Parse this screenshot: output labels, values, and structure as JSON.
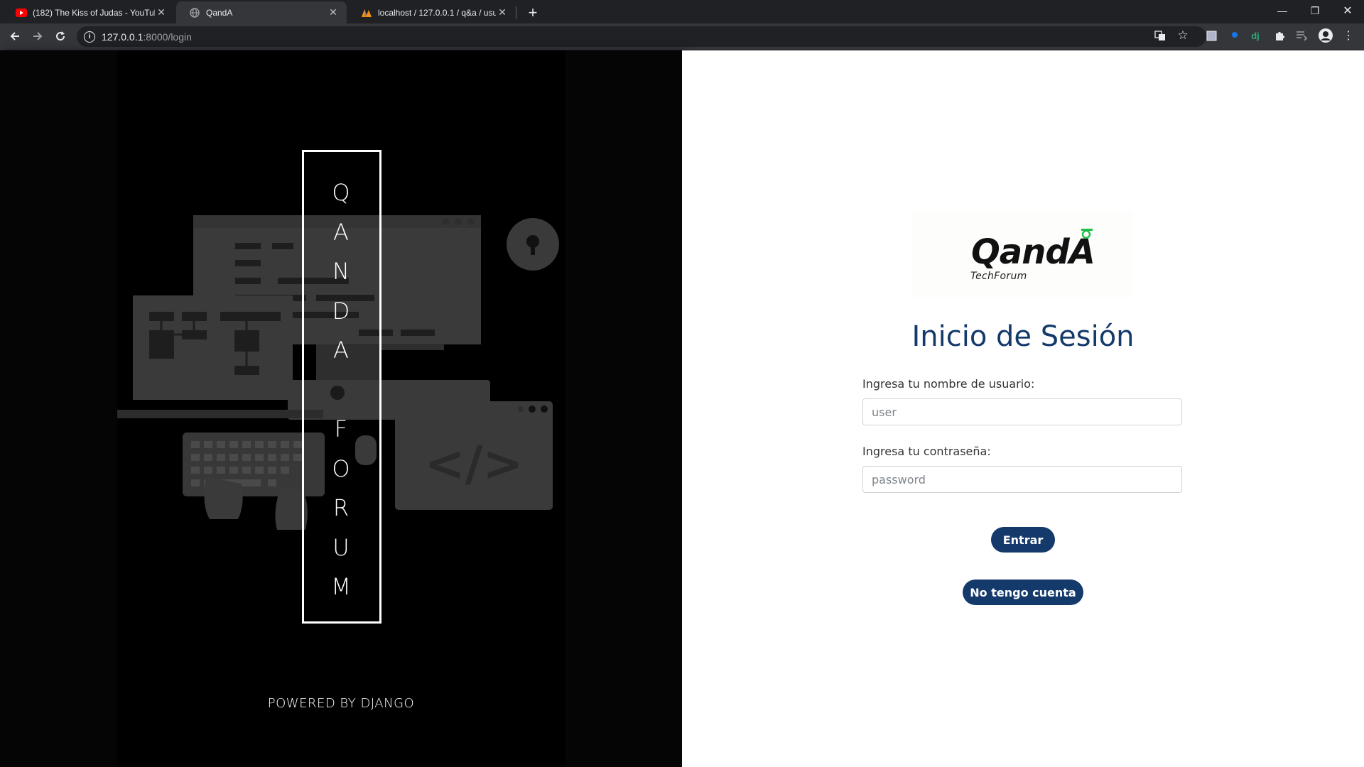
{
  "browser": {
    "tabs": [
      {
        "title": "(182) The Kiss of Judas - YouTube",
        "icon": "youtube-icon"
      },
      {
        "title": "QandA",
        "icon": "globe-icon"
      },
      {
        "title": "localhost / 127.0.0.1 / q&a / usuario",
        "icon": "phpmyadmin-icon"
      }
    ],
    "url_host": "127.0.0.1",
    "url_path": ":8000/login"
  },
  "left": {
    "title_letters_top": [
      "Q",
      "A",
      "N",
      "D",
      "A"
    ],
    "title_letters_bottom": [
      "F",
      "O",
      "R",
      "U",
      "M"
    ],
    "code_symbol": "</>",
    "powered_by": "POWERED BY DJANGO"
  },
  "right": {
    "logo_text": "QandA",
    "logo_sub": "TechForum",
    "heading": "Inicio de Sesión",
    "username_label": "Ingresa tu nombre de usuario:",
    "username_placeholder": "user",
    "password_label": "Ingresa tu contraseña:",
    "password_placeholder": "password",
    "submit_label": "Entrar",
    "register_label": "No tengo cuenta"
  },
  "colors": {
    "accent": "#143a6b",
    "logo_mark": "#1fbf4a",
    "chrome_dark": "#202124",
    "chrome_tab": "#35363a"
  }
}
